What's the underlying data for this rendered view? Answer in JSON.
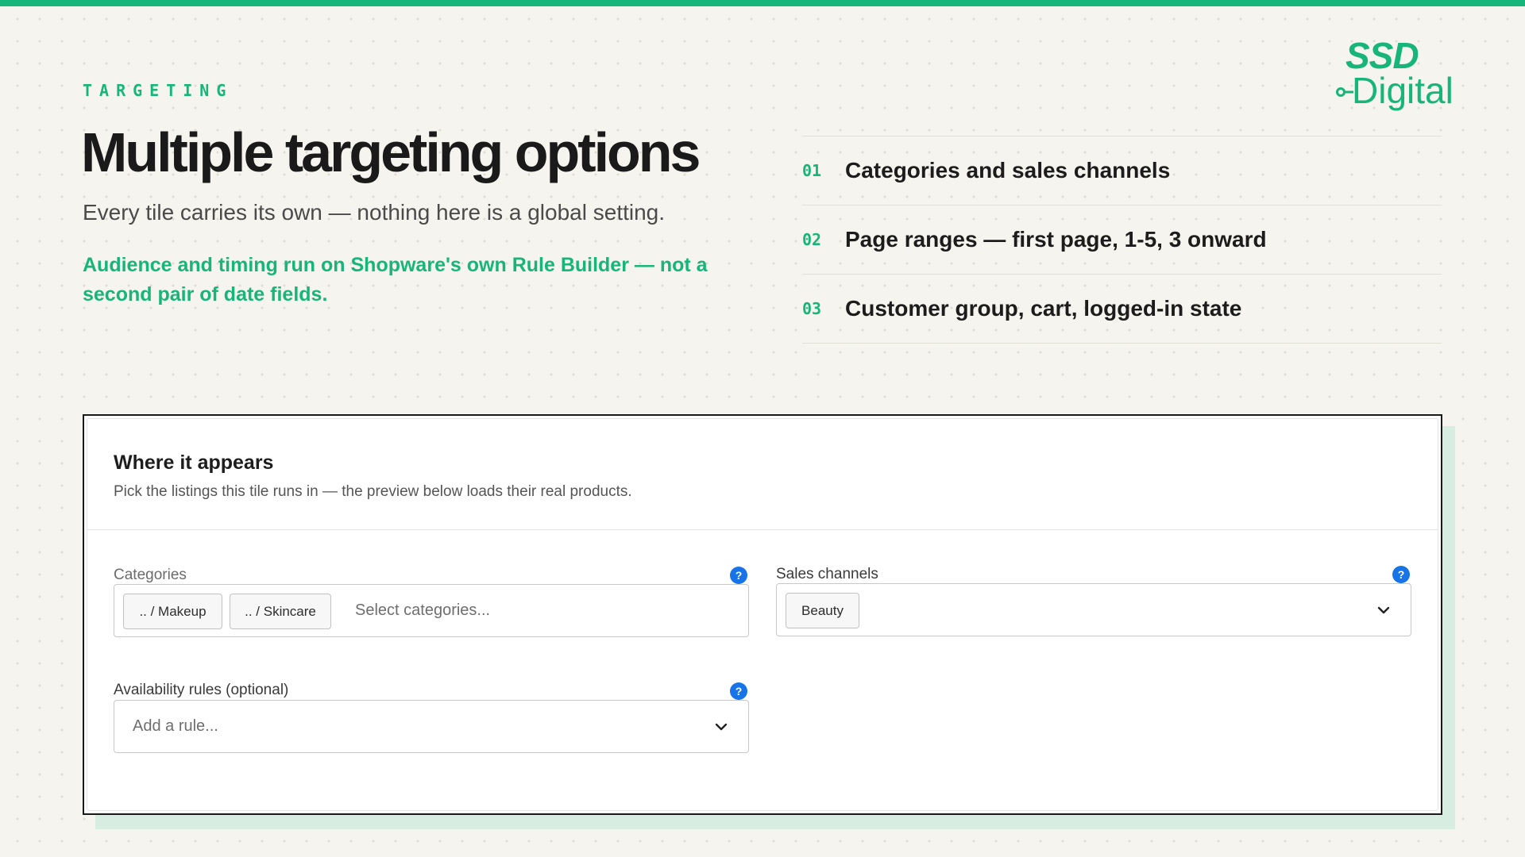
{
  "brand": {
    "logo_primary": "SSD",
    "logo_secondary": "Digital",
    "accent_color": "#17b57a"
  },
  "hero": {
    "kicker": "TARGETING",
    "title": "Multiple targeting options",
    "subtitle": "Every tile carries its own — nothing here is a global setting.",
    "highlight": "Audience and timing run on Shopware's own Rule Builder — not a second pair of date fields."
  },
  "features": [
    {
      "num": "01",
      "text": "Categories and sales channels"
    },
    {
      "num": "02",
      "text": "Page ranges — first page, 1-5, 3 onward"
    },
    {
      "num": "03",
      "text": "Customer group, cart, logged-in state"
    }
  ],
  "panel": {
    "title": "Where it appears",
    "description": "Pick the listings this tile runs in — the preview below loads their real products.",
    "categories": {
      "label": "Categories",
      "chips": [
        ".. / Makeup",
        ".. / Skincare"
      ],
      "placeholder": "Select categories..."
    },
    "sales_channels": {
      "label": "Sales channels",
      "chips": [
        "Beauty"
      ]
    },
    "availability": {
      "label": "Availability rules (optional)",
      "placeholder": "Add a rule..."
    },
    "help_glyph": "?"
  }
}
